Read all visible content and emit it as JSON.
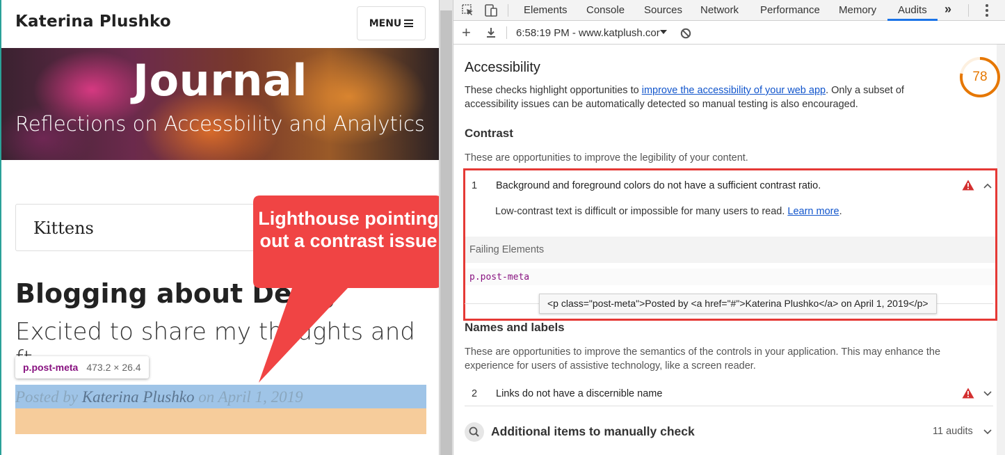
{
  "site": {
    "brand": "Katerina Plushko",
    "menu_label": "MENU",
    "hero_title": "Journal",
    "hero_subtitle": "Reflections on Accessbility and Analytics",
    "card_title": "Kittens",
    "post_title": "Blogging about Desig",
    "post_subtitle": "Excited to share my thoughts and ft...",
    "post_meta_prefix": "Posted by ",
    "post_meta_author": "Katerina Plushko",
    "post_meta_suffix": " on April 1, 2019",
    "inspect_tooltip": {
      "selector": "p.post-meta",
      "dimensions": "473.2 × 26.4"
    }
  },
  "annotation": {
    "callout_text": "Lighthouse pointing out a contrast issue",
    "callout_color": "#f04444"
  },
  "devtools": {
    "tabs": [
      "Elements",
      "Console",
      "Sources",
      "Network",
      "Performance",
      "Memory",
      "Audits"
    ],
    "active_tab": "Audits",
    "more_tabs": "»",
    "toolbar": {
      "report_label": "6:58:19 PM - www.katplush.cor"
    },
    "accessibility": {
      "title": "Accessibility",
      "score": "78",
      "desc_before": "These checks highlight opportunities to ",
      "desc_link": "improve the accessibility of your web app",
      "desc_after": ". Only a subset of accessibility issues can be automatically detected so manual testing is also encouraged."
    },
    "contrast": {
      "heading": "Contrast",
      "description": "These are opportunities to improve the legibility of your content.",
      "audit": {
        "number": "1",
        "title": "Background and foreground colors do not have a sufficient contrast ratio.",
        "detail": "Low-contrast text is difficult or impossible for many users to read. ",
        "learn_more": "Learn more",
        "detail_end": ".",
        "failing_header": "Failing Elements",
        "failing_element": "p.post-meta",
        "snippet": "<p class=\"post-meta\">Posted by <a href=\"#\">Katerina Plushko</a> on April 1, 2019</p>"
      }
    },
    "names": {
      "heading": "Names and labels",
      "description": "These are opportunities to improve the semantics of the controls in your application. This may enhance the experience for users of assistive technology, like a screen reader.",
      "audit": {
        "number": "2",
        "title": "Links do not have a discernible name"
      }
    },
    "manual": {
      "title": "Additional items to manually check",
      "count": "11 audits"
    },
    "colors": {
      "score_arc": "#e67700",
      "warning": "#d32f2f",
      "link": "#1155cc",
      "highlight_box": "#e53935"
    }
  }
}
